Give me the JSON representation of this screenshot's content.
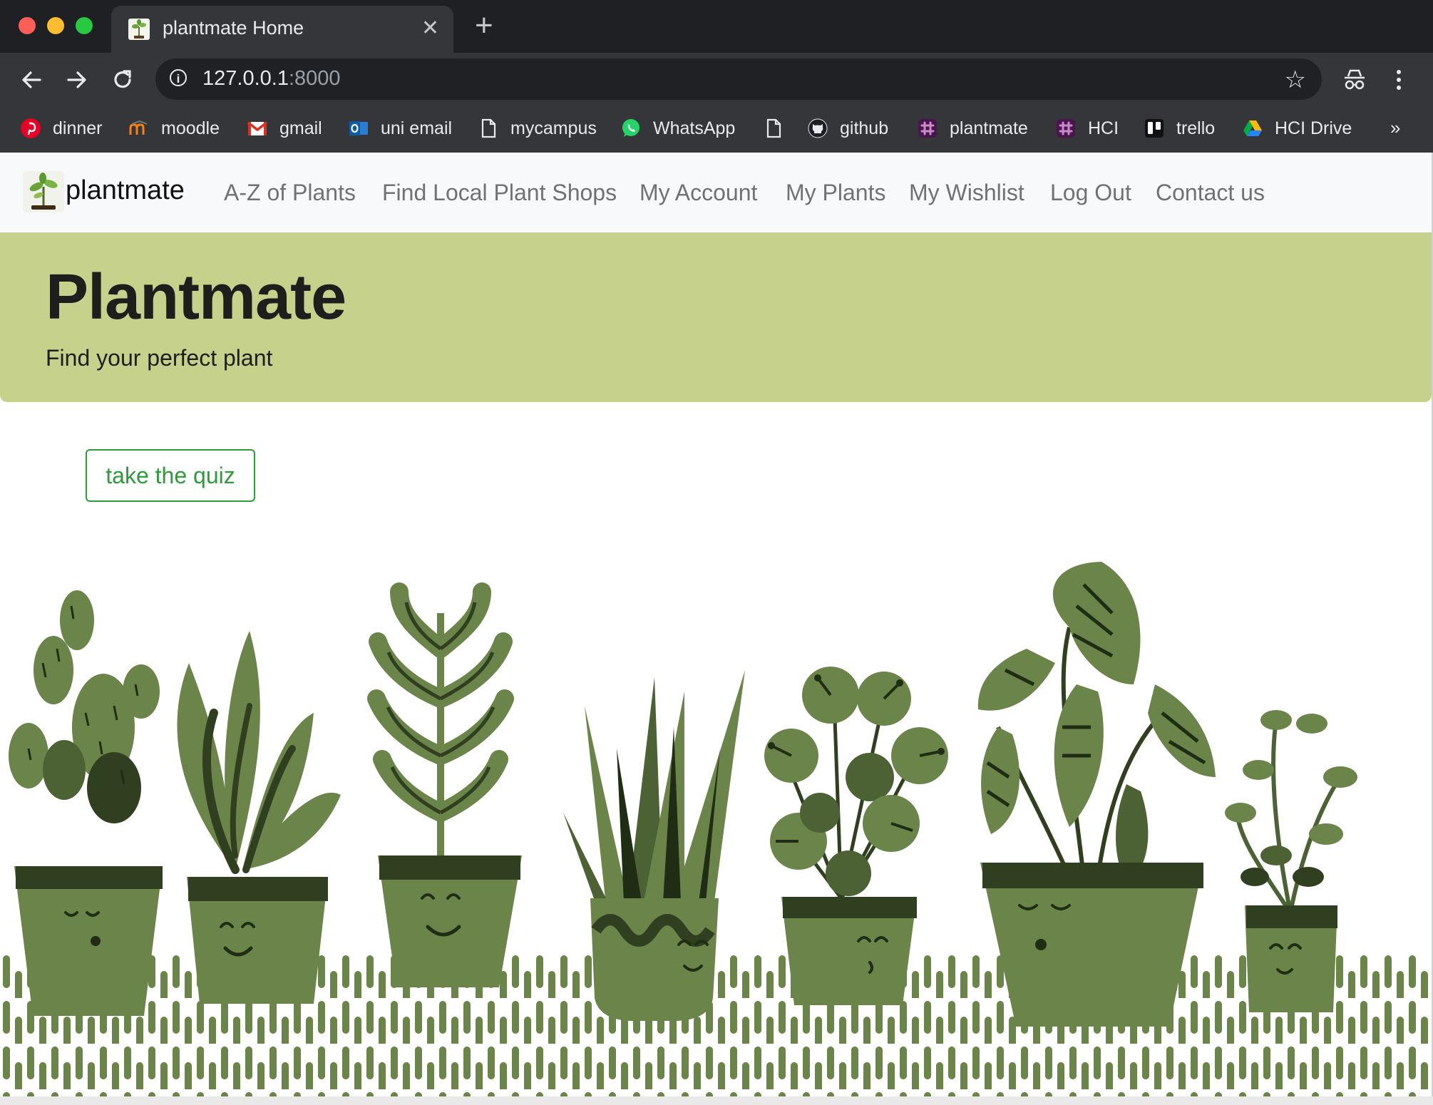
{
  "browser": {
    "tab_title": "plantmate Home",
    "url_host": "127.0.0.1",
    "url_port": ":8000",
    "bookmarks": [
      {
        "label": "dinner",
        "icon": "pinterest-icon"
      },
      {
        "label": "moodle",
        "icon": "moodle-icon"
      },
      {
        "label": "gmail",
        "icon": "gmail-icon"
      },
      {
        "label": "uni email",
        "icon": "outlook-icon"
      },
      {
        "label": "mycampus",
        "icon": "page-icon"
      },
      {
        "label": "WhatsApp",
        "icon": "whatsapp-icon"
      },
      {
        "label": "",
        "icon": "page-icon"
      },
      {
        "label": "github",
        "icon": "github-icon"
      },
      {
        "label": "plantmate",
        "icon": "slack-icon"
      },
      {
        "label": "HCI",
        "icon": "slack-icon"
      },
      {
        "label": "trello",
        "icon": "trello-icon"
      },
      {
        "label": "HCI Drive",
        "icon": "drive-icon"
      }
    ],
    "more_glyph": "»"
  },
  "colors": {
    "hero_bg": "#c6d18c",
    "accent_green": "#2e9a3c",
    "plant_green": "#6b8449",
    "plant_dark": "#1f2d14"
  },
  "navbar": {
    "brand": "plantmate",
    "links": [
      "A-Z of Plants",
      "Find Local Plant Shops",
      "My Account",
      "My Plants",
      "My Wishlist",
      "Log Out",
      "Contact us"
    ]
  },
  "hero": {
    "title": "Plantmate",
    "subtitle": "Find your perfect plant"
  },
  "quiz_button": "take the quiz"
}
